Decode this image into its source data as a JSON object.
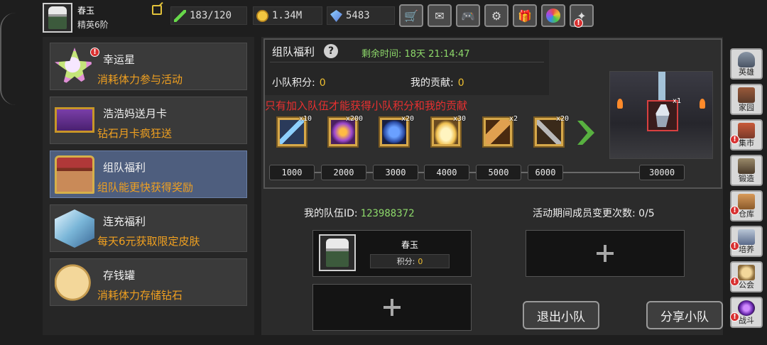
{
  "player": {
    "name": "春玉",
    "rank": "精英6阶"
  },
  "resources": [
    {
      "icon": "energy-icon",
      "value": "183/120"
    },
    {
      "icon": "coin-icon",
      "value": "1.34M"
    },
    {
      "icon": "gem-icon",
      "value": "5483"
    }
  ],
  "top_buttons": [
    "shop-icon",
    "mail-icon",
    "gamepad-icon",
    "settings-icon",
    "gift-icon",
    "lucky-wheel-icon",
    "event-icon"
  ],
  "menu": {
    "items": [
      {
        "title": "幸运星",
        "desc": "消耗体力参与活动",
        "icon": "lucky-star-icon",
        "badge": "!"
      },
      {
        "title": "浩浩妈送月卡",
        "desc": "钻石月卡疯狂送",
        "icon": "month-card-icon"
      },
      {
        "title": "组队福利",
        "desc": "组队能更快获得奖励",
        "icon": "treasure-chest-icon",
        "active": true
      },
      {
        "title": "连充福利",
        "desc": "每天6元获取限定皮肤",
        "icon": "crystal-cube-icon"
      },
      {
        "title": "存钱罐",
        "desc": "消耗体力存储钻石",
        "icon": "piggy-bank-icon"
      }
    ]
  },
  "team_welfare": {
    "title": "组队福利",
    "help": "?",
    "timer": "剩余时间: 18天 21:14:47",
    "team_score_label": "小队积分:",
    "team_score": "0",
    "my_contrib_label": "我的贡献:",
    "my_contrib": "0",
    "warning": "只有加入队伍才能获得小队积分和我的贡献",
    "rewards": [
      {
        "icon": "lightning-icon",
        "qty": "x10"
      },
      {
        "icon": "fire-orb-icon",
        "qty": "x200"
      },
      {
        "icon": "blue-rune-icon",
        "qty": "x20"
      },
      {
        "icon": "golden-egg-icon",
        "qty": "x30"
      },
      {
        "icon": "scroll-icon",
        "qty": "x2"
      },
      {
        "icon": "hammer-icon",
        "qty": "x20"
      }
    ],
    "milestones": [
      "1000",
      "2000",
      "3000",
      "4000",
      "5000",
      "6000"
    ],
    "grand_milestone": "30000",
    "grand_reward": {
      "icon": "hero-skin-icon",
      "qty": "x1"
    }
  },
  "team": {
    "id_label": "我的队伍ID:",
    "id": "123988372",
    "changes_label": "活动期间成员变更次数:",
    "changes": "0/5",
    "member": {
      "name": "春玉",
      "score_label": "积分:",
      "score": "0"
    },
    "leave_button": "退出小队",
    "share_button": "分享小队"
  },
  "sidebar": [
    {
      "label": "英雄",
      "icon": "hero-helmet-icon"
    },
    {
      "label": "家园",
      "icon": "castle-icon"
    },
    {
      "label": "集市",
      "icon": "market-icon",
      "badge": "!"
    },
    {
      "label": "锻造",
      "icon": "anvil-icon"
    },
    {
      "label": "仓库",
      "icon": "warehouse-icon",
      "badge": "!"
    },
    {
      "label": "培养",
      "icon": "cultivate-icon",
      "badge": "!"
    },
    {
      "label": "公会",
      "icon": "guild-icon",
      "badge": "!"
    },
    {
      "label": "战斗",
      "icon": "battle-portal-icon",
      "badge": "!"
    }
  ]
}
